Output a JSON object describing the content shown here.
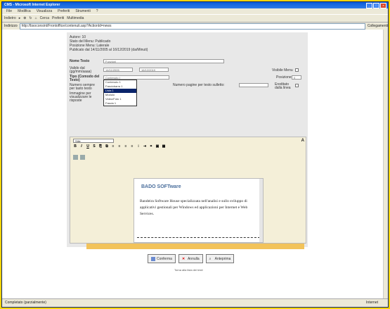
{
  "window": {
    "title": "CMS - Microsoft Internet Explorer"
  },
  "menu": [
    "File",
    "Modifica",
    "Visualizza",
    "Preferiti",
    "Strumenti",
    "?"
  ],
  "toolbar": {
    "back": "Indietro",
    "search": "Cerca",
    "favorites": "Preferiti",
    "media": "Multimedia"
  },
  "address": {
    "label": "Indirizzo",
    "url": "http://bsoconsint/Frontoffice/contenuti.asp?ActionId=news",
    "go_label": "Collegamenti"
  },
  "info": {
    "author": "Autore: 10",
    "status": "Stato del Menu: Publicado",
    "position": "Posizione Menu: Laterale",
    "published": "Publicato dal 14/11/2005 al 16/12/2019 (da/Minuti)"
  },
  "form": {
    "name_label": "Nome Testo",
    "name_value": "Funzioni",
    "date_label": "Valido dal (gg/mm/aaaa)",
    "date_from": "14/11/2005",
    "date_to": "16/12/2019",
    "type_label": "Tipo (Comodo del Testo)",
    "type_value": "Contenuto (",
    "clicks_label": "Numero sempre per tasto testo",
    "image_label": "Immagine per visualizzare le risposte",
    "visible_label": "Visibile Menu",
    "order_label": "Posizione",
    "order_value": "0",
    "page_label": "Numero pagine per testo sulletto:",
    "notes_label": "Ereditato dalla linea",
    "options": [
      "Contenuto 1",
      "Fasciobarra 1",
      "Lista 1",
      "Modulo",
      "Video/Foto 1",
      "Fascia 1"
    ]
  },
  "editor": {
    "style_value": "Stile",
    "doc_logo": "BADO SOFTware",
    "doc_text": "Bandeira Software House specializzata nell'analisi e sullo sviluppo di applicativi gestionali per Windows ed applicazioni per Internet e Web Services."
  },
  "buttons": {
    "confirm": "Conferma",
    "cancel": "Annulla",
    "preview": "Anteprima"
  },
  "footer": "Torna alla lista dei testi",
  "status": {
    "left": "Completato (parzialmente)",
    "right": "Internet"
  }
}
